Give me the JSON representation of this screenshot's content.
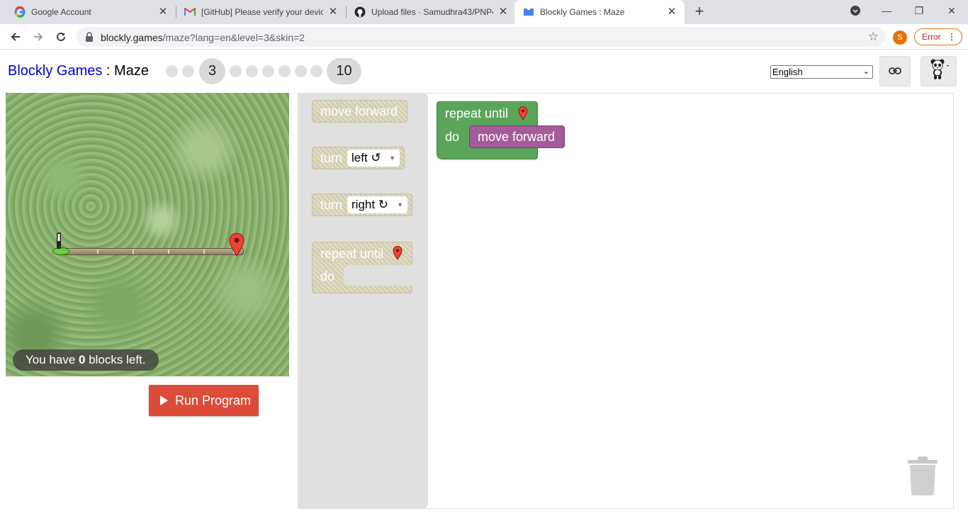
{
  "browser": {
    "tabs": [
      {
        "title": "Google Account",
        "icon": "google-icon",
        "active": false
      },
      {
        "title": "[GitHub] Please verify your device",
        "icon": "gmail-icon",
        "active": false
      },
      {
        "title": "Upload files · Samudhra43/PNP4",
        "icon": "github-icon",
        "active": false
      },
      {
        "title": "Blockly Games : Maze",
        "icon": "blockly-icon",
        "active": true
      }
    ],
    "url_host": "blockly.games",
    "url_path": "/maze?lang=en&level=3&skin=2",
    "profile_initial": "S",
    "error_label": "Error"
  },
  "header": {
    "title_link": "Blockly Games",
    "title_sep": " : ",
    "title_page": "Maze",
    "current_level": "3",
    "last_level": "10",
    "language": "English"
  },
  "maze": {
    "blocks_left_prefix": "You have ",
    "blocks_left_count": "0",
    "blocks_left_suffix": " blocks left."
  },
  "run_button": "Run Program",
  "toolbox": {
    "move_forward": "move forward",
    "turn": "turn",
    "left": "left ↺",
    "right": "right ↻",
    "repeat_until": "repeat until",
    "do": "do"
  },
  "workspace": {
    "repeat_until": "repeat until",
    "do": "do",
    "move_forward": "move forward"
  },
  "colors": {
    "loop_block": "#5ba55b",
    "move_block": "#a55b99",
    "run_button": "#dd4b39",
    "disabled_block": "#d3cdb0"
  }
}
